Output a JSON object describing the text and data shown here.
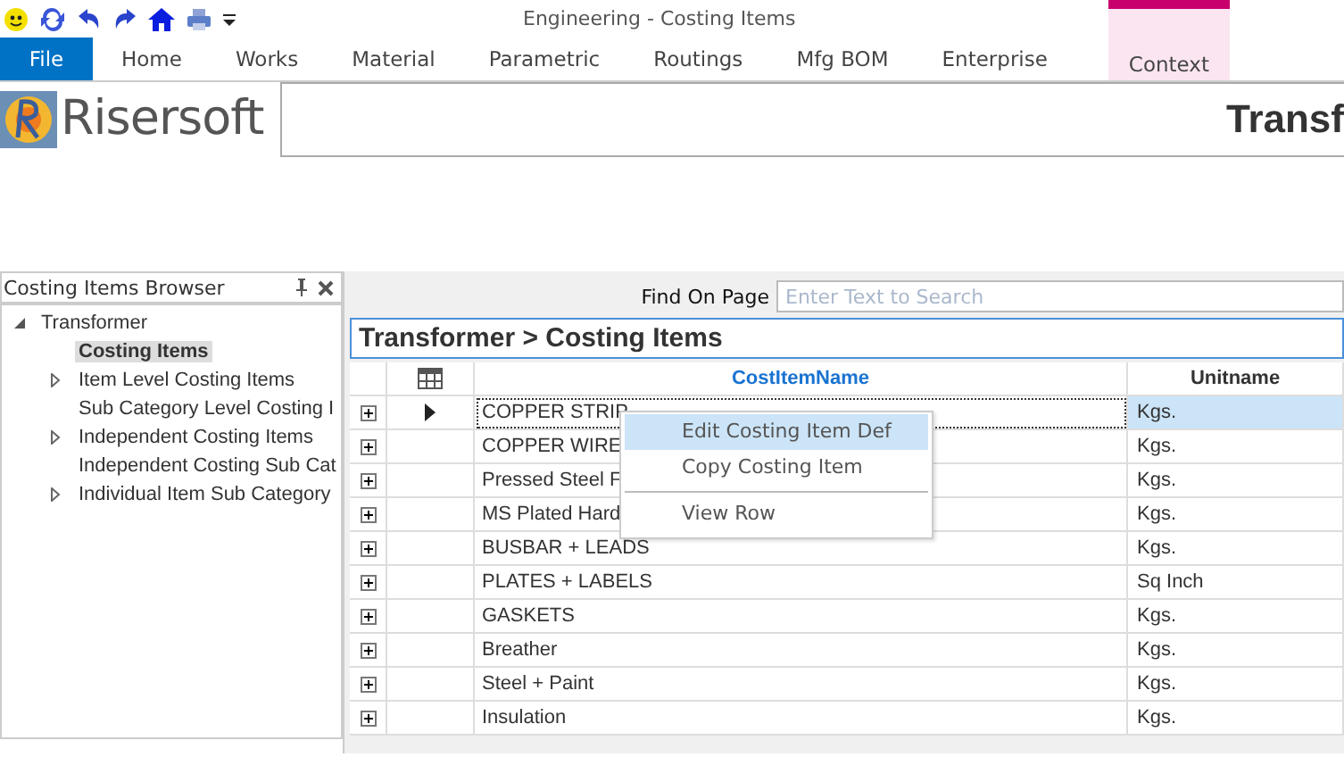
{
  "window": {
    "title": "Engineering - Costing Items"
  },
  "ribbon_tabs": [
    {
      "label": "File",
      "kind": "file",
      "selected": false
    },
    {
      "label": "Home",
      "kind": "tab",
      "selected": false
    },
    {
      "label": "Works",
      "kind": "tab",
      "selected": false
    },
    {
      "label": "Material",
      "kind": "tab",
      "selected": false
    },
    {
      "label": "Parametric",
      "kind": "tab",
      "selected": false
    },
    {
      "label": "Routings",
      "kind": "tab",
      "selected": false
    },
    {
      "label": "Mfg BOM",
      "kind": "tab",
      "selected": false
    },
    {
      "label": "Enterprise",
      "kind": "tab",
      "selected": false
    },
    {
      "label": "Context",
      "kind": "context",
      "selected": false
    }
  ],
  "brand": {
    "name": "Risersoft",
    "page_heading": "Transf"
  },
  "browser": {
    "title": "Costing Items Browser",
    "tree": [
      {
        "label": "Transformer",
        "expanded": true,
        "children": [
          {
            "label": "Costing Items",
            "selected": true,
            "has_children": false
          },
          {
            "label": "Item Level Costing Items",
            "selected": false,
            "has_children": true
          },
          {
            "label": "Sub Category Level Costing I",
            "selected": false,
            "has_children": false
          },
          {
            "label": "Independent Costing Items",
            "selected": false,
            "has_children": true
          },
          {
            "label": "Independent Costing Sub Cat",
            "selected": false,
            "has_children": false
          },
          {
            "label": "Individual Item Sub Category",
            "selected": false,
            "has_children": true
          }
        ]
      }
    ]
  },
  "find": {
    "label": "Find On Page",
    "placeholder": "Enter Text to Search"
  },
  "breadcrumb": "Transformer > Costing Items",
  "table": {
    "columns": [
      "CostItemName",
      "Unitname"
    ],
    "rows": [
      {
        "name": "COPPER STRIP",
        "unit": "Kgs.",
        "selected": true
      },
      {
        "name": "COPPER WIRE",
        "unit": "Kgs.",
        "selected": false
      },
      {
        "name": "Pressed Steel F",
        "unit": "Kgs.",
        "selected": false
      },
      {
        "name": "MS Plated Hard",
        "unit": "Kgs.",
        "selected": false
      },
      {
        "name": "BUSBAR + LEADS",
        "unit": "Kgs.",
        "selected": false
      },
      {
        "name": "PLATES + LABELS",
        "unit": "Sq Inch",
        "selected": false
      },
      {
        "name": "GASKETS",
        "unit": "Kgs.",
        "selected": false
      },
      {
        "name": "Breather",
        "unit": "Kgs.",
        "selected": false
      },
      {
        "name": "Steel + Paint",
        "unit": "Kgs.",
        "selected": false
      },
      {
        "name": "Insulation",
        "unit": "Kgs.",
        "selected": false
      }
    ]
  },
  "context_menu": [
    {
      "label": "Edit Costing Item Def",
      "selected": true,
      "separator_before": false
    },
    {
      "label": "Copy Costing Item",
      "selected": false,
      "separator_before": false
    },
    {
      "label": "View Row",
      "selected": false,
      "separator_before": true
    }
  ]
}
